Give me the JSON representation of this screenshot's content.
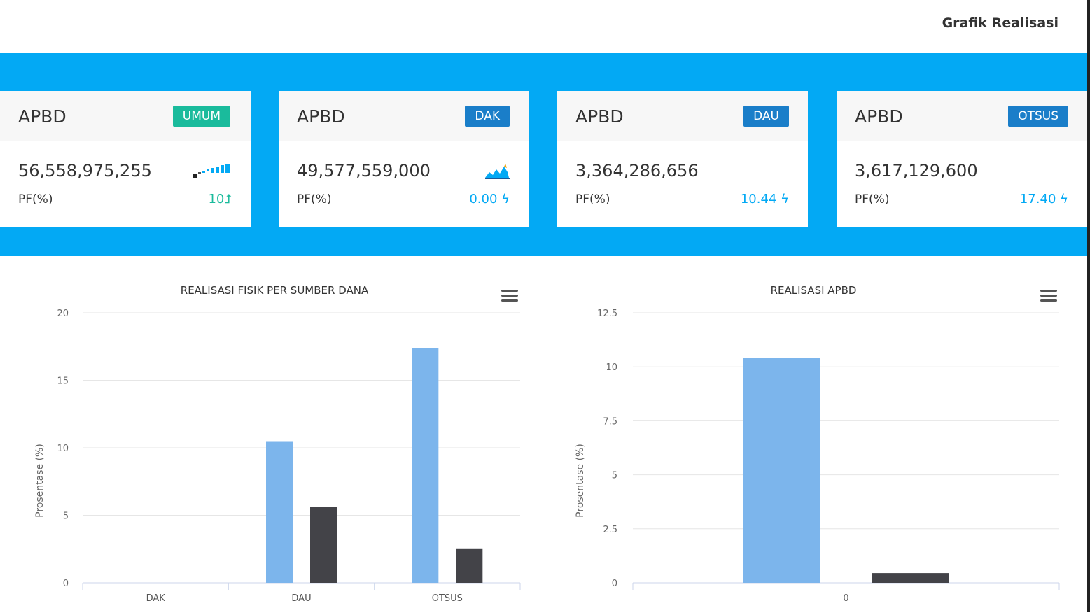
{
  "header": {
    "title": "Grafik Realisasi"
  },
  "cards": [
    {
      "title": "APBD",
      "badge": "UMUM",
      "badge_color": "#1abb9c",
      "value": "56,558,975,255",
      "pf_label": "PF(%)",
      "pf_value": "10",
      "pf_color": "#1abb9c",
      "icon": "signal-bars-icon"
    },
    {
      "title": "APBD",
      "badge": "DAK",
      "badge_color": "#1a7ec9",
      "value": "49,577,559,000",
      "pf_label": "PF(%)",
      "pf_value": "0.00",
      "pf_color": "#03a9f4",
      "icon": "area-chart-icon"
    },
    {
      "title": "APBD",
      "badge": "DAU",
      "badge_color": "#1a7ec9",
      "value": "3,364,286,656",
      "pf_label": "PF(%)",
      "pf_value": "10.44",
      "pf_color": "#03a9f4",
      "icon": ""
    },
    {
      "title": "APBD",
      "badge": "OTSUS",
      "badge_color": "#1a7ec9",
      "value": "3,617,129,600",
      "pf_label": "PF(%)",
      "pf_value": "17.40",
      "pf_color": "#03a9f4",
      "icon": ""
    }
  ],
  "chart_data": [
    {
      "type": "bar",
      "title": "REALISASI FISIK PER SUMBER DANA",
      "ylabel": "Prosentase (%)",
      "xlabel": "",
      "categories": [
        "DAK",
        "DAU",
        "OTSUS"
      ],
      "ylim": [
        0,
        20
      ],
      "yticks": [
        "0",
        "5",
        "10",
        "15",
        "20"
      ],
      "grid": true,
      "series": [
        {
          "color": "#7cb5ec",
          "values": [
            0,
            10.44,
            17.4
          ]
        },
        {
          "color": "#434348",
          "values": [
            0,
            5.6,
            2.55
          ]
        }
      ]
    },
    {
      "type": "bar",
      "title": "REALISASI APBD",
      "ylabel": "Prosentase (%)",
      "xlabel": "",
      "categories": [
        "0"
      ],
      "ylim": [
        0,
        12.5
      ],
      "yticks": [
        "0",
        "2.5",
        "5",
        "7.5",
        "10",
        "12.5"
      ],
      "grid": true,
      "series": [
        {
          "color": "#7cb5ec",
          "values": [
            10.4
          ]
        },
        {
          "color": "#434348",
          "values": [
            0.45
          ]
        }
      ]
    }
  ]
}
